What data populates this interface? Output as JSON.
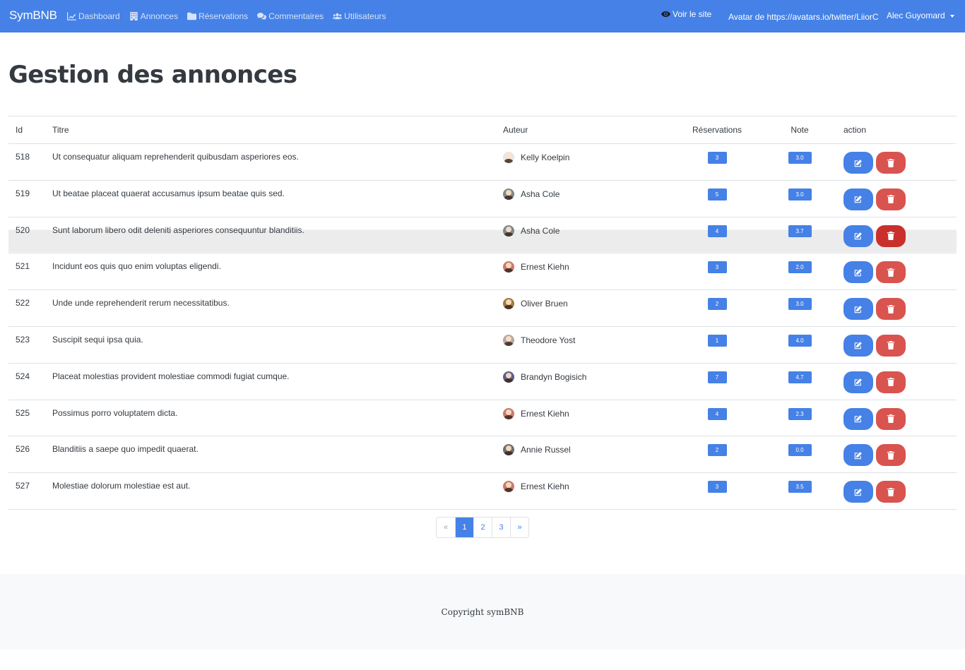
{
  "navbar": {
    "brand": "SymBNB",
    "links": [
      {
        "label": "Dashboard",
        "icon": "chart-line-icon"
      },
      {
        "label": "Annonces",
        "icon": "building-icon"
      },
      {
        "label": "Réservations",
        "icon": "folder-icon"
      },
      {
        "label": "Commentaires",
        "icon": "comments-icon"
      },
      {
        "label": "Utilisateurs",
        "icon": "users-icon"
      }
    ],
    "view_site": "Voir le site",
    "user_avatar_alt": "Avatar de https://avatars.io/twitter/LiiorC",
    "user_name": "Alec Guyomard"
  },
  "page": {
    "title": "Gestion des annonces"
  },
  "table": {
    "headers": {
      "id": "Id",
      "title": "Titre",
      "author": "Auteur",
      "reservations": "Réservations",
      "note": "Note",
      "action": "action"
    },
    "rows": [
      {
        "id": "518",
        "title": "Ut consequatur aliquam reprehenderit quibusdam asperiores eos.",
        "author": "Kelly Koelpin",
        "reservations": "3",
        "note": "3.0",
        "avatar_color": "#e9e6e1"
      },
      {
        "id": "519",
        "title": "Ut beatae placeat quaerat accusamus ipsum beatae quis sed.",
        "author": "Asha Cole",
        "reservations": "5",
        "note": "3.0",
        "avatar_color": "#7b8a86"
      },
      {
        "id": "520",
        "title": "Sunt laborum libero odit deleniti asperiores consequuntur blanditiis.",
        "author": "Asha Cole",
        "reservations": "4",
        "note": "3.7",
        "avatar_color": "#7b8a86"
      },
      {
        "id": "521",
        "title": "Incidunt eos quis quo enim voluptas eligendi.",
        "author": "Ernest Kiehn",
        "reservations": "3",
        "note": "2.0",
        "avatar_color": "#c97a6a"
      },
      {
        "id": "522",
        "title": "Unde unde reprehenderit rerum necessitatibus.",
        "author": "Oliver Bruen",
        "reservations": "2",
        "note": "3.0",
        "avatar_color": "#a07b3c"
      },
      {
        "id": "523",
        "title": "Suscipit sequi ipsa quia.",
        "author": "Theodore Yost",
        "reservations": "1",
        "note": "4.0",
        "avatar_color": "#b6a8a0"
      },
      {
        "id": "524",
        "title": "Placeat molestias provident molestiae commodi fugiat cumque.",
        "author": "Brandyn Bogisich",
        "reservations": "7",
        "note": "4.7",
        "avatar_color": "#5a5f86"
      },
      {
        "id": "525",
        "title": "Possimus porro voluptatem dicta.",
        "author": "Ernest Kiehn",
        "reservations": "4",
        "note": "2.3",
        "avatar_color": "#c97a6a"
      },
      {
        "id": "526",
        "title": "Blanditiis a saepe quo impedit quaerat.",
        "author": "Annie Russel",
        "reservations": "2",
        "note": "0.0",
        "avatar_color": "#6e6e6e"
      },
      {
        "id": "527",
        "title": "Molestiae dolorum molestiae est aut.",
        "author": "Ernest Kiehn",
        "reservations": "3",
        "note": "3.5",
        "avatar_color": "#c97a6a"
      }
    ]
  },
  "pagination": {
    "prev": "«",
    "pages": [
      "1",
      "2",
      "3"
    ],
    "active": "1",
    "next": "»"
  },
  "footer": {
    "copyright": "Copyright symBNB"
  },
  "colors": {
    "primary": "#4581e6",
    "danger": "#d9534f",
    "text": "#343a40",
    "footer_bg": "#f8f9fa"
  }
}
